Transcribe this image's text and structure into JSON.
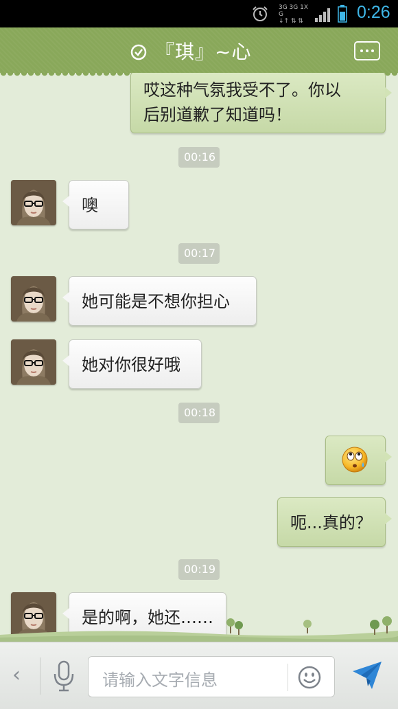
{
  "status_bar": {
    "time": "0:26",
    "net_line1": "3G 3G 1X  G",
    "net_line2": "↓↑ ⇅ ⇅",
    "icons": [
      "alarm-icon",
      "signal-icon",
      "battery-icon"
    ]
  },
  "header": {
    "title": "『琪』~心",
    "status_icon": "online-check-icon",
    "menu_icon": "more-icon"
  },
  "messages": [
    {
      "direction": "out",
      "text_line1": "哎这种气氛我受不了。你以",
      "text_line2": "后别道歉了知道吗！"
    },
    {
      "time": "00:16"
    },
    {
      "direction": "in",
      "text": "噢"
    },
    {
      "time": "00:17"
    },
    {
      "direction": "in",
      "text": "她可能是不想你担心"
    },
    {
      "direction": "in",
      "text": "她对你很好哦"
    },
    {
      "time": "00:18"
    },
    {
      "direction": "out",
      "emoji": "rolling-eyes-emoji"
    },
    {
      "direction": "out",
      "text": "呃...真的？"
    },
    {
      "time": "00:19"
    },
    {
      "direction": "in",
      "text": "是的啊，她还……"
    }
  ],
  "input_bar": {
    "placeholder": "请输入文字信息",
    "back": "‹",
    "icons": [
      "voice-mic-icon",
      "emoji-smiley-icon",
      "send-icon"
    ]
  },
  "colors": {
    "header_green": "#89a85a",
    "chat_background": "#e3ecd9",
    "outgoing_bubble": "#cfe0b2",
    "incoming_bubble": "#f6f6f6",
    "status_time": "#3fb7e8"
  }
}
